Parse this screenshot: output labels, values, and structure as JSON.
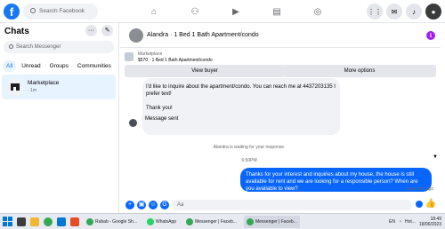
{
  "topbar": {
    "search_placeholder": "Search Facebook",
    "logo_letter": "f"
  },
  "sidebar": {
    "title": "Chats",
    "search_placeholder": "Search Messenger",
    "filters": [
      "All",
      "Unread",
      "Groups",
      "Communities"
    ],
    "active_filter": "All",
    "conversation": {
      "name": "Marketplace",
      "sub": "· 1m"
    }
  },
  "chat": {
    "title": "Alandra · 1 Bed 1 Bath Apartment/condo",
    "marketplace_label": "Marketplace",
    "price_line": "$570 · 1 Bed 1 Bath Apartment/condo",
    "view_buyer": "View buyer",
    "more_options": "More options",
    "incoming_message_1": "I'd like to inquire about the apartment/condo. You can reach me at 4437203135 I prefer text!",
    "incoming_message_2": "Thank you!",
    "message_sent": "Message sent",
    "waiting": "Alandra is waiting for your response.",
    "timestamp": "6:50PM",
    "outgoing_message": "Thanks for your interest and inquiries about my house, the house is still available for rent and we are looking for a responsible person? When are you available to view?",
    "seen": "Seen 1m ago",
    "composer_placeholder": "Aa"
  },
  "taskbar": {
    "apps": [
      "Rubab - Google Sh...",
      "WhatsApp",
      "Messenger | Faceb...",
      "Messenger | Faceb..."
    ],
    "language": "EN",
    "weather": "Hot...",
    "time": "18:49",
    "date": "18/06/2023"
  },
  "colors": {
    "accent": "#0866ff",
    "selected_conv": "#e7f3ff",
    "info": "#a020f0"
  }
}
